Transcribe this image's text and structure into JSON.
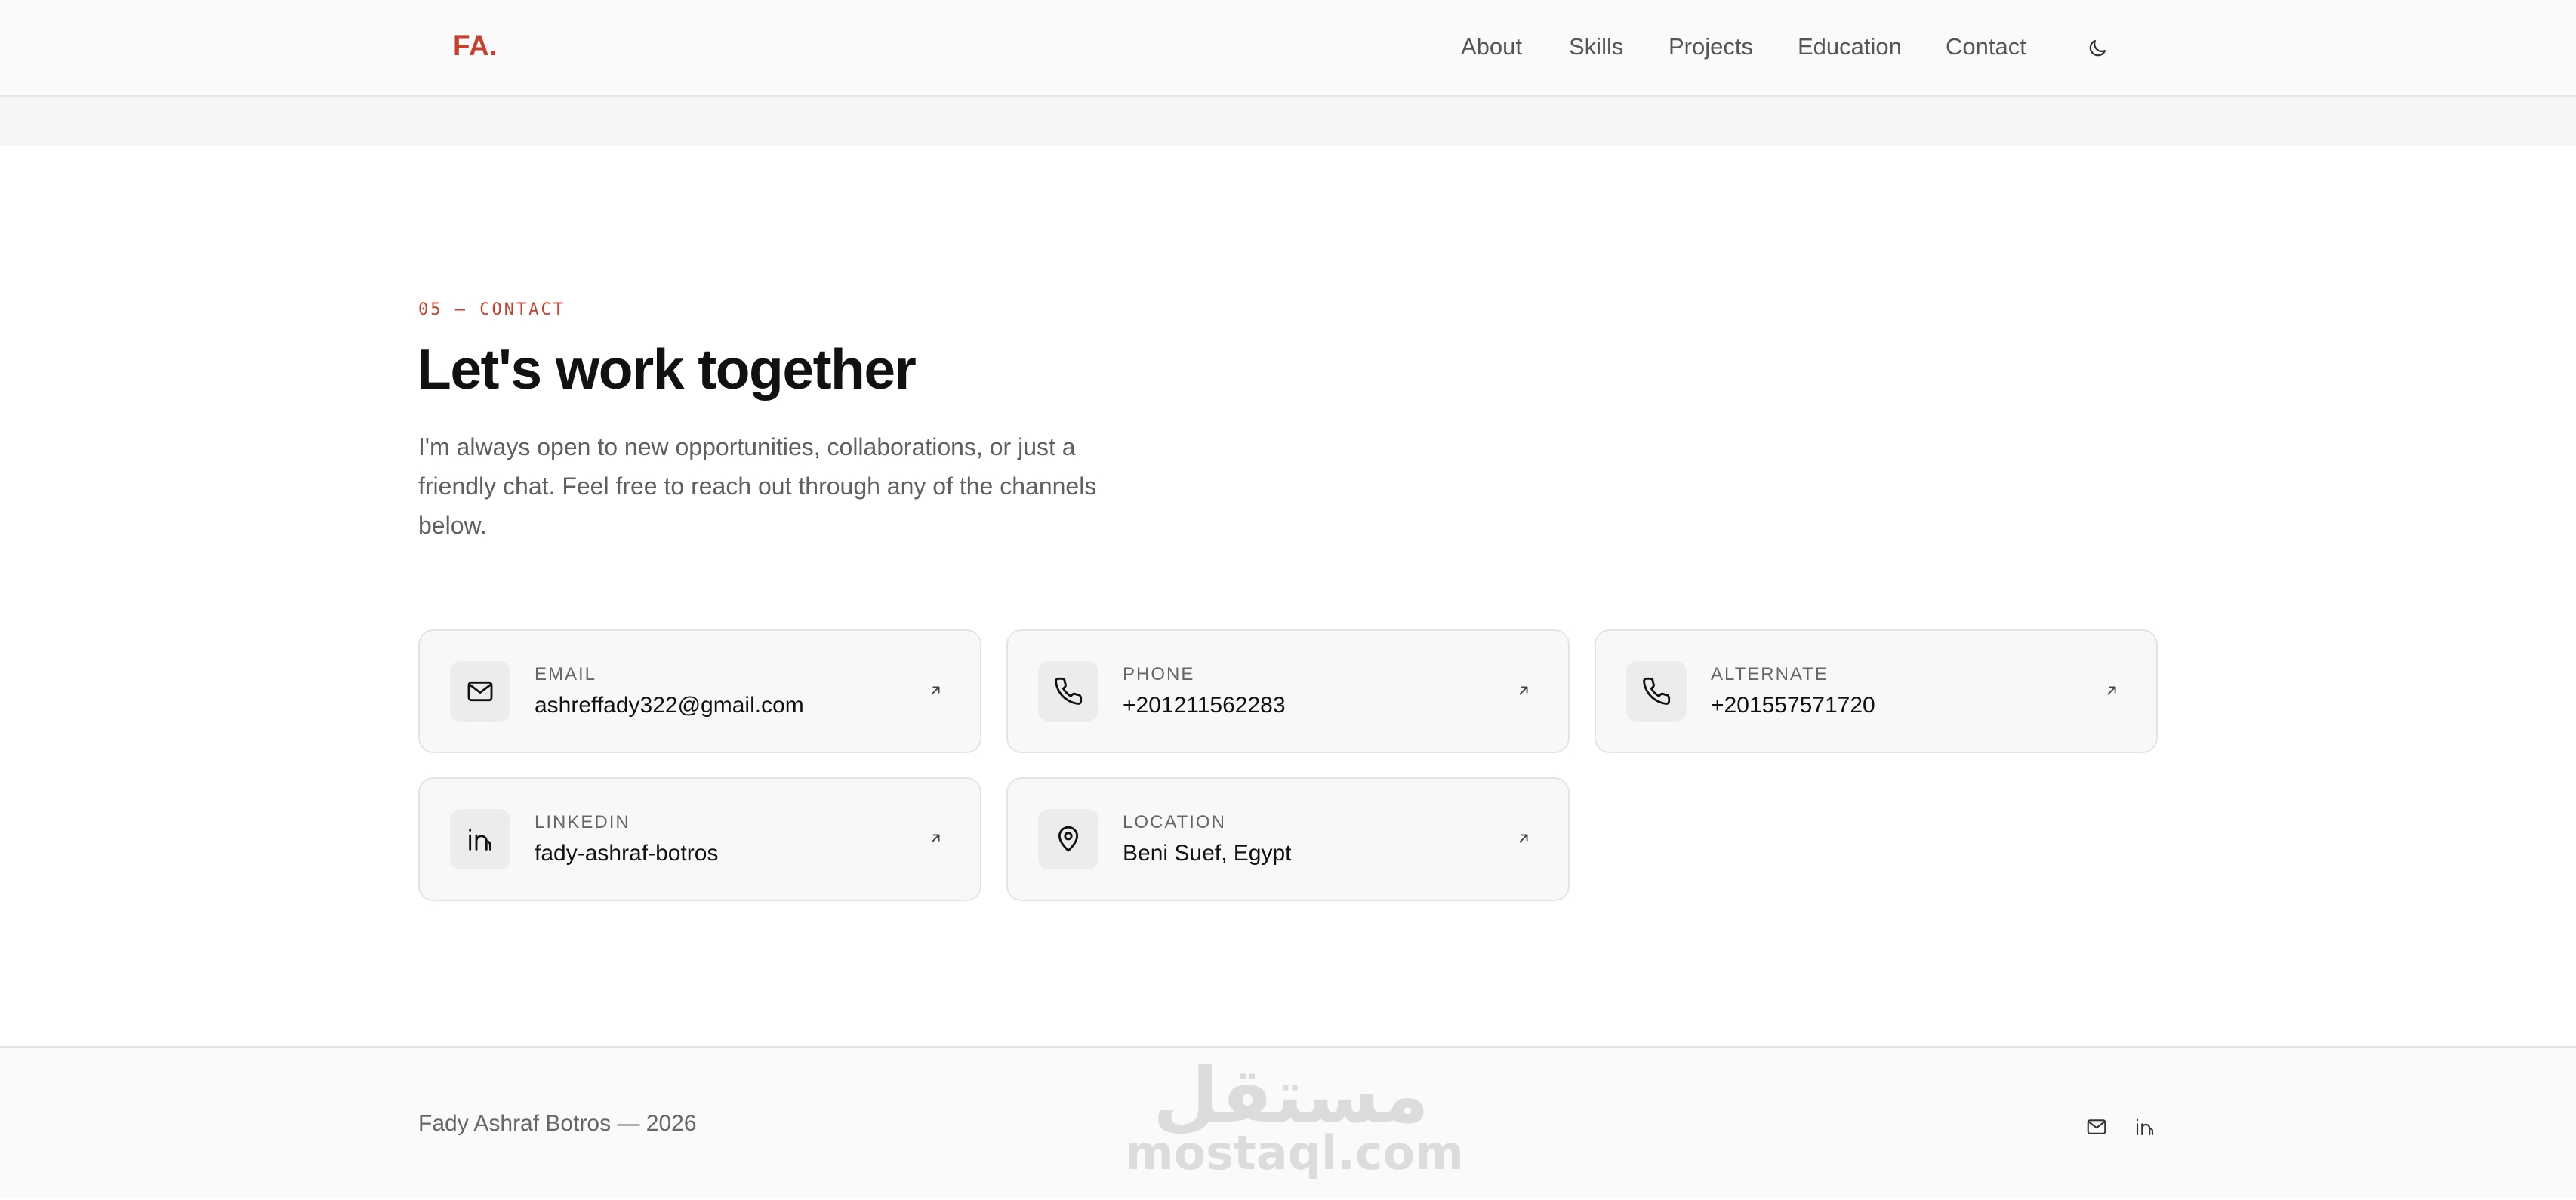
{
  "header": {
    "logo": "FA.",
    "nav": [
      {
        "label": "About"
      },
      {
        "label": "Skills"
      },
      {
        "label": "Projects"
      },
      {
        "label": "Education"
      },
      {
        "label": "Contact"
      }
    ],
    "theme_icon": "moon-icon"
  },
  "contact": {
    "eyebrow": "05 — CONTACT",
    "title": "Let's work together",
    "intro": "I'm always open to new opportunities, collaborations, or just a friendly chat. Feel free to reach out through any of the channels below.",
    "cards": [
      {
        "icon": "mail-icon",
        "label": "EMAIL",
        "value": "ashreffady322@gmail.com"
      },
      {
        "icon": "phone-icon",
        "label": "PHONE",
        "value": "+201211562283"
      },
      {
        "icon": "phone-icon",
        "label": "ALTERNATE",
        "value": "+201557571720"
      },
      {
        "icon": "linkedin-icon",
        "label": "LINKEDIN",
        "value": "fady-ashraf-botros"
      },
      {
        "icon": "map-pin-icon",
        "label": "LOCATION",
        "value": "Beni Suef, Egypt"
      }
    ]
  },
  "footer": {
    "copyright": "Fady Ashraf Botros — 2026",
    "watermark_arabic": "مستقل",
    "watermark_latin": "mostaql.com",
    "icons": [
      "mail-icon",
      "linkedin-icon"
    ]
  },
  "colors": {
    "accent": "#c8402d",
    "text": "#111111",
    "muted": "#666666",
    "card_bg": "#f8f8f8",
    "card_border": "#e4e4e4"
  }
}
